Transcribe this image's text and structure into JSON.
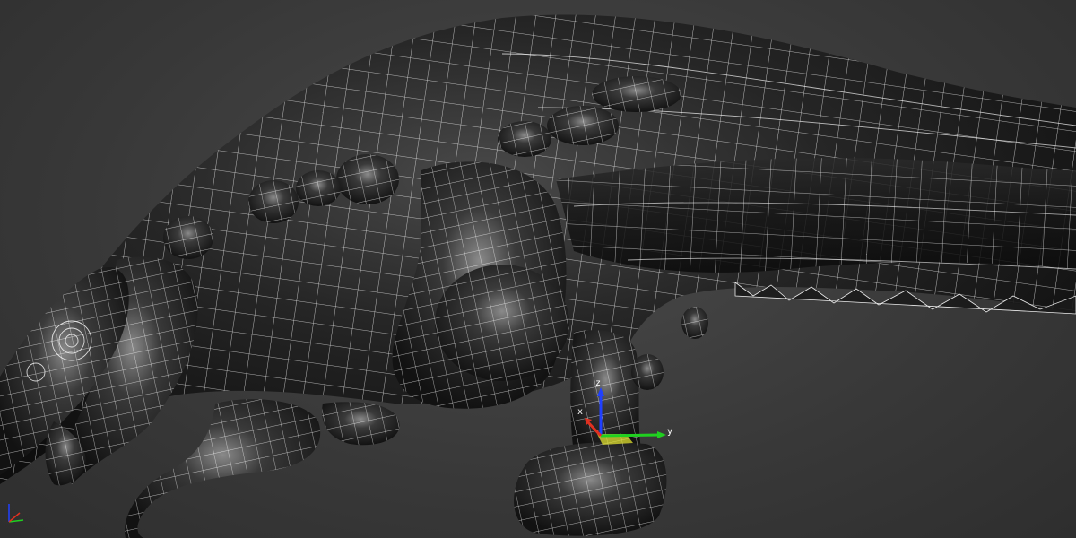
{
  "viewport": {
    "background": "#3a3a3a",
    "wireframe_color": "#ffffff",
    "mesh_fill_dark": "#141414",
    "mesh_fill_light": "#5a5a5a"
  },
  "gizmo": {
    "x_label": "x",
    "y_label": "y",
    "z_label": "z",
    "x_color": "#e03020",
    "y_color": "#20d020",
    "z_color": "#2040ff",
    "plane_color": "#e0e030"
  },
  "view_axis": {
    "x_color": "#e03020",
    "y_color": "#20d020",
    "z_color": "#2040ff"
  }
}
